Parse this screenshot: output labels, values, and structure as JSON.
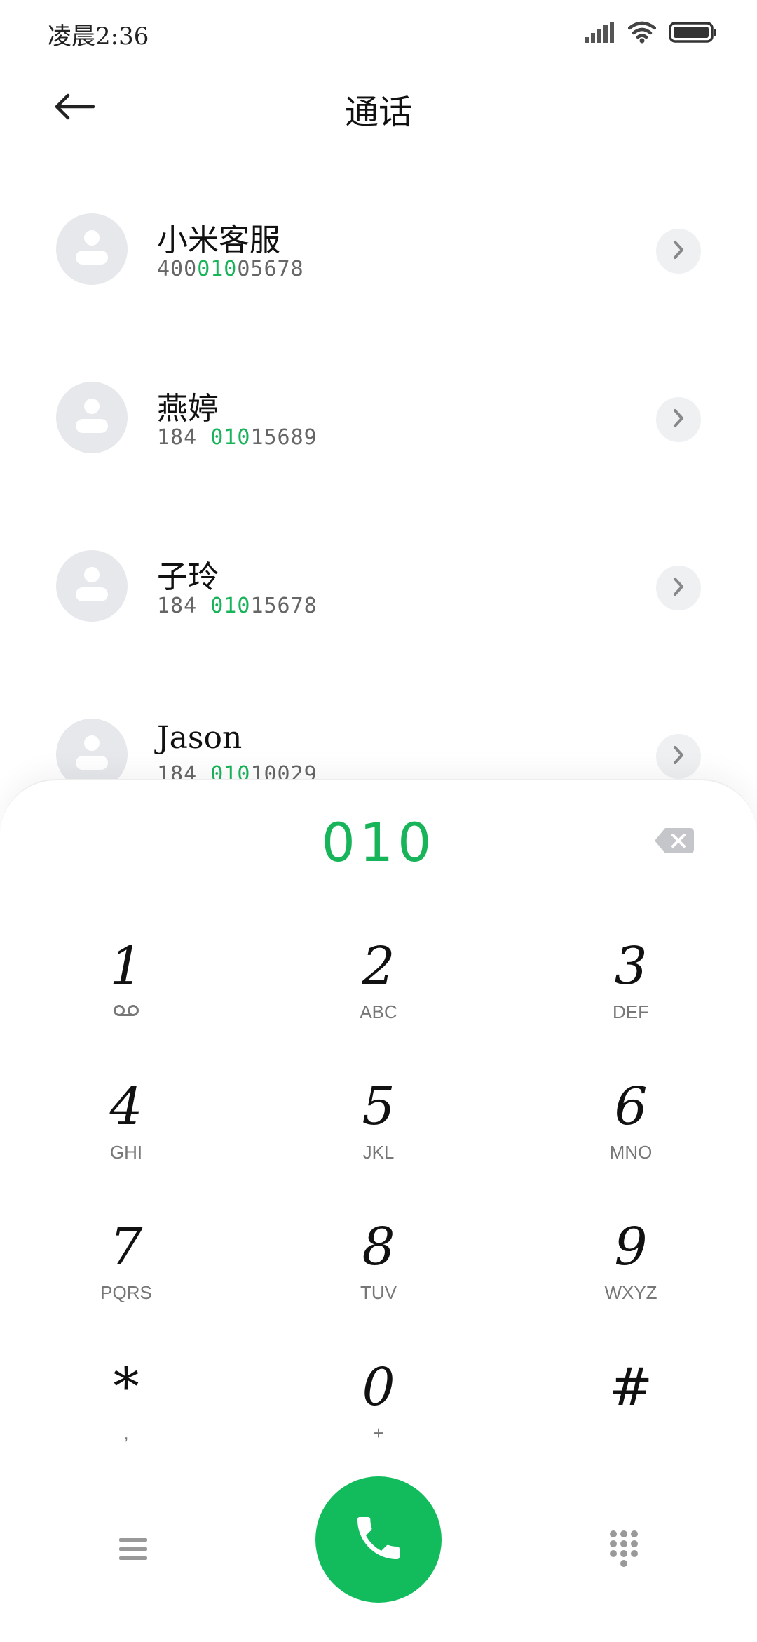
{
  "status_bar": {
    "time": "凌晨2:36",
    "icons": [
      "signal-icon",
      "wifi-icon",
      "battery-icon"
    ]
  },
  "header": {
    "title": "通话",
    "back_icon": "back-arrow-icon"
  },
  "contacts": [
    {
      "name": "小米客服",
      "number_parts": [
        "400",
        "010",
        "05678"
      ]
    },
    {
      "name": "燕婷",
      "number_parts": [
        "184 ",
        "010",
        "15689"
      ]
    },
    {
      "name": "子玲",
      "number_parts": [
        "184 ",
        "010",
        "15678"
      ]
    },
    {
      "name": "Jason",
      "number_parts": [
        "184 ",
        "010",
        "10029"
      ]
    }
  ],
  "dialer": {
    "input_value": "010",
    "backspace_icon": "backspace-icon",
    "keys": [
      {
        "digit": "1",
        "sub": "voicemail-icon"
      },
      {
        "digit": "2",
        "sub": "ABC"
      },
      {
        "digit": "3",
        "sub": "DEF"
      },
      {
        "digit": "4",
        "sub": "GHI"
      },
      {
        "digit": "5",
        "sub": "JKL"
      },
      {
        "digit": "6",
        "sub": "MNO"
      },
      {
        "digit": "7",
        "sub": "PQRS"
      },
      {
        "digit": "8",
        "sub": "TUV"
      },
      {
        "digit": "9",
        "sub": "WXYZ"
      },
      {
        "digit": "*",
        "sub": ","
      },
      {
        "digit": "0",
        "sub": "+"
      },
      {
        "digit": "#",
        "sub": ""
      }
    ]
  },
  "bottom_bar": {
    "menu_icon": "menu-icon",
    "call_icon": "phone-icon",
    "dialpad_icon": "dialpad-icon"
  },
  "colors": {
    "accent_green": "#18b45a",
    "call_button": "#12bc5c",
    "avatar_bg": "#e6e8ec"
  }
}
